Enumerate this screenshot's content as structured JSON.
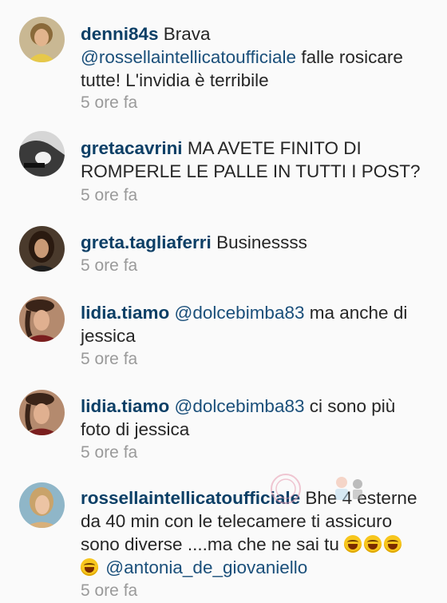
{
  "comments": [
    {
      "username": "denni84s",
      "text_parts": [
        " Brava ",
        "@rossellaintellicatoufficiale",
        " falle rosicare tutte! L'invidia è terribile"
      ],
      "time": "5 ore fa",
      "avatar": "avatar-blonde-woman"
    },
    {
      "username": "gretacavrini",
      "text_parts": [
        " MA AVETE FINITO DI ROMPERLE LE PALLE IN TUTTI I POST?"
      ],
      "time": "5 ore fa",
      "avatar": "avatar-bw-photo"
    },
    {
      "username": "greta.tagliaferri",
      "text_parts": [
        " Businessss"
      ],
      "time": "5 ore fa",
      "avatar": "avatar-dark-hair-woman"
    },
    {
      "username": "lidia.tiamo",
      "text_parts": [
        " ",
        "@dolcebimba83",
        " ma anche di jessica"
      ],
      "time": "5 ore fa",
      "avatar": "avatar-woman-beret"
    },
    {
      "username": "lidia.tiamo",
      "text_parts": [
        " ",
        "@dolcebimba83",
        " ci sono più foto di jessica"
      ],
      "time": "5 ore fa",
      "avatar": "avatar-woman-beret"
    },
    {
      "username": "rossellaintellicatoufficiale",
      "text_parts": [
        " Bhe 4 esterne da 40 min con le telecamere ti assicuro sono diverse ....ma che ne sai tu ",
        "@antonia_de_giovaniello"
      ],
      "time": "5 ore fa",
      "avatar": "avatar-light-hair-woman",
      "emoji_count": 4
    }
  ],
  "colors": {
    "username": "#0c3f66",
    "mention": "#1a4f7a",
    "text": "#262626",
    "time": "#9a9a9a",
    "background": "#fafafa"
  }
}
